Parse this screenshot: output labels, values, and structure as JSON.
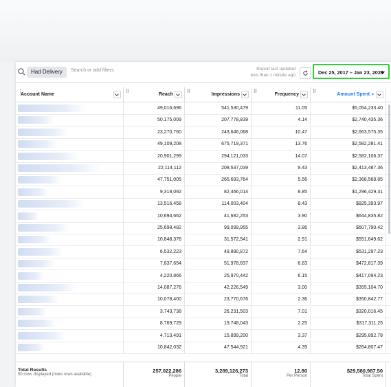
{
  "filters": {
    "chip": "Had Delivery",
    "placeholder": "Search or add filters",
    "report_updated_line1": "Report last updated",
    "report_updated_line2": "less than 1 minute ago",
    "date_range": "Dec 25, 2017 – Jan 23, 2020"
  },
  "columns": {
    "account": "Account Name",
    "reach": "Reach",
    "impressions": "Impressions",
    "frequency": "Frequency",
    "amount": "Amount Spent"
  },
  "colors": {
    "accent": "#1877f2",
    "highlight_border": "#2fcf3b"
  },
  "rows": [
    {
      "reach": "49,016,696",
      "impressions": "541,530,479",
      "frequency": "11.05",
      "amount": "$5,054,233.40"
    },
    {
      "reach": "50,175,009",
      "impressions": "207,778,839",
      "frequency": "4.14",
      "amount": "$2,740,435.36"
    },
    {
      "reach": "23,270,760",
      "impressions": "243,646,068",
      "frequency": "10.47",
      "amount": "$2,663,575.35"
    },
    {
      "reach": "49,109,208",
      "impressions": "675,719,371",
      "frequency": "13.76",
      "amount": "$2,582,281.41"
    },
    {
      "reach": "20,901,299",
      "impressions": "294,121,033",
      "frequency": "14.07",
      "amount": "$2,582,106.37"
    },
    {
      "reach": "22,114,112",
      "impressions": "208,537,039",
      "frequency": "9.43",
      "amount": "$2,413,487.36"
    },
    {
      "reach": "47,751,005",
      "impressions": "265,693,764",
      "frequency": "5.56",
      "amount": "$2,368,568.85"
    },
    {
      "reach": "9,318,092",
      "impressions": "82,466,014",
      "frequency": "8.85",
      "amount": "$1,296,429.31"
    },
    {
      "reach": "13,516,458",
      "impressions": "114,003,404",
      "frequency": "8.43",
      "amount": "$825,393.97"
    },
    {
      "reach": "10,694,662",
      "impressions": "41,682,253",
      "frequency": "3.90",
      "amount": "$644,835.82"
    },
    {
      "reach": "25,698,482",
      "impressions": "99,099,955",
      "frequency": "3.86",
      "amount": "$607,790.42"
    },
    {
      "reach": "10,848,376",
      "impressions": "31,572,541",
      "frequency": "2.91",
      "amount": "$551,649.62"
    },
    {
      "reach": "6,532,223",
      "impressions": "49,890,872",
      "frequency": "7.64",
      "amount": "$531,297.23"
    },
    {
      "reach": "7,837,654",
      "impressions": "51,978,837",
      "frequency": "6.63",
      "amount": "$472,817.39"
    },
    {
      "reach": "4,220,866",
      "impressions": "25,970,442",
      "frequency": "6.15",
      "amount": "$417,094.23"
    },
    {
      "reach": "14,087,276",
      "impressions": "42,226,549",
      "frequency": "3.00",
      "amount": "$355,104.70"
    },
    {
      "reach": "10,078,400",
      "impressions": "23,770,676",
      "frequency": "2.36",
      "amount": "$350,842.77"
    },
    {
      "reach": "3,743,738",
      "impressions": "26,231,503",
      "frequency": "7.01",
      "amount": "$320,016.45"
    },
    {
      "reach": "8,769,729",
      "impressions": "19,748,043",
      "frequency": "2.25",
      "amount": "$317,311.25"
    },
    {
      "reach": "4,713,491",
      "impressions": "15,899,200",
      "frequency": "3.37",
      "amount": "$295,892.78"
    },
    {
      "reach": "10,842,032",
      "impressions": "47,544,921",
      "frequency": "4.39",
      "amount": "$264,807.47"
    }
  ],
  "totals": {
    "label": "Total Results",
    "sublabel": "50 rows displayed (more rows available)",
    "reach": "257,022,286",
    "reach_sub": "People",
    "impressions": "3,289,126,273",
    "impressions_sub": "Total",
    "frequency": "12.80",
    "frequency_sub": "Per Person",
    "amount": "$29,580,987.50",
    "amount_sub": "Total Spent"
  }
}
